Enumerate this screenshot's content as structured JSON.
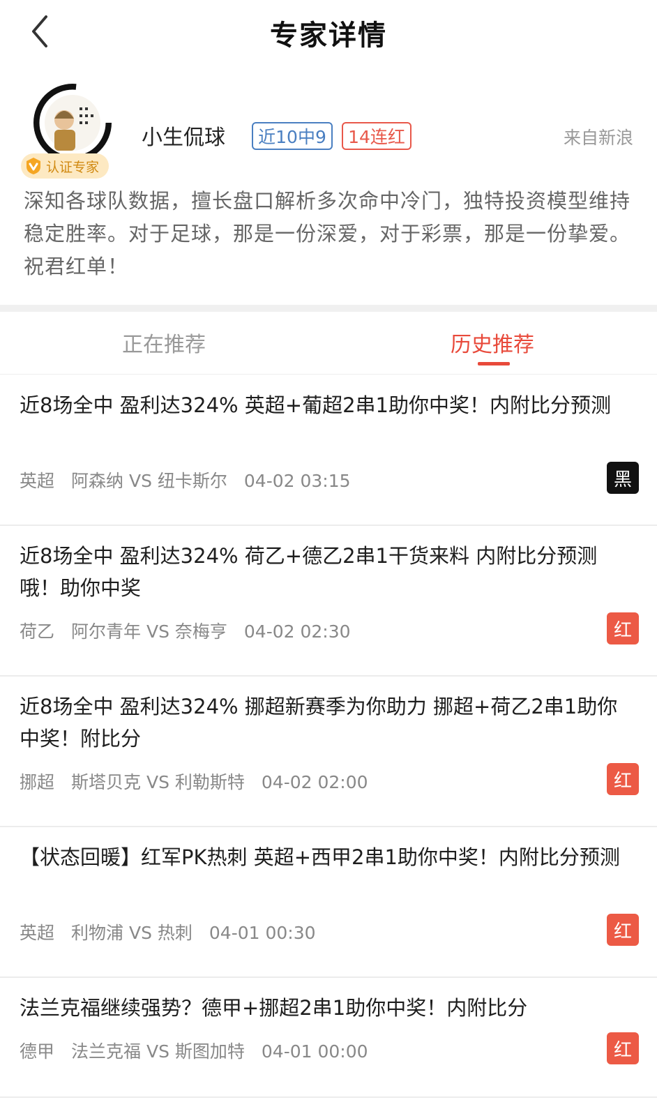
{
  "header": {
    "title": "专家详情"
  },
  "expert": {
    "name": "小生侃球",
    "cert_label": "认证专家",
    "badge_recent": "近10中9",
    "badge_streak": "14连红",
    "source": "来自新浪",
    "bio": "深知各球队数据，擅长盘口解析多次命中冷门，独特投资模型维持稳定胜率。对于足球，那是一份深爱，对于彩票，那是一份挚爱。祝君红单！"
  },
  "tabs": {
    "current": "正在推荐",
    "history": "历史推荐",
    "active": "history"
  },
  "items": [
    {
      "title": "近8场全中 盈利达324% 英超+葡超2串1助你中奖！内附比分预测",
      "league": "英超",
      "match": "阿森纳 VS 纽卡斯尔",
      "time": "04-02 03:15",
      "result": "黑"
    },
    {
      "title": "近8场全中 盈利达324% 荷乙+德乙2串1干货来料 内附比分预测哦！助你中奖",
      "league": "荷乙",
      "match": "阿尔青年 VS 奈梅亨",
      "time": "04-02 02:30",
      "result": "红"
    },
    {
      "title": "近8场全中 盈利达324% 挪超新赛季为你助力 挪超+荷乙2串1助你中奖！附比分",
      "league": "挪超",
      "match": "斯塔贝克 VS 利勒斯特",
      "time": "04-02 02:00",
      "result": "红"
    },
    {
      "title": "【状态回暖】红军PK热刺 英超+西甲2串1助你中奖！内附比分预测",
      "league": "英超",
      "match": "利物浦 VS 热刺",
      "time": "04-01 00:30",
      "result": "红"
    },
    {
      "title": "法兰克福继续强势？德甲+挪超2串1助你中奖！内附比分",
      "league": "德甲",
      "match": "法兰克福 VS 斯图加特",
      "time": "04-01 00:00",
      "result": "红"
    }
  ],
  "colors": {
    "accent": "#e8493a",
    "blue": "#4a7fc1",
    "result_red": "#ec5a45",
    "result_black": "#111111"
  }
}
